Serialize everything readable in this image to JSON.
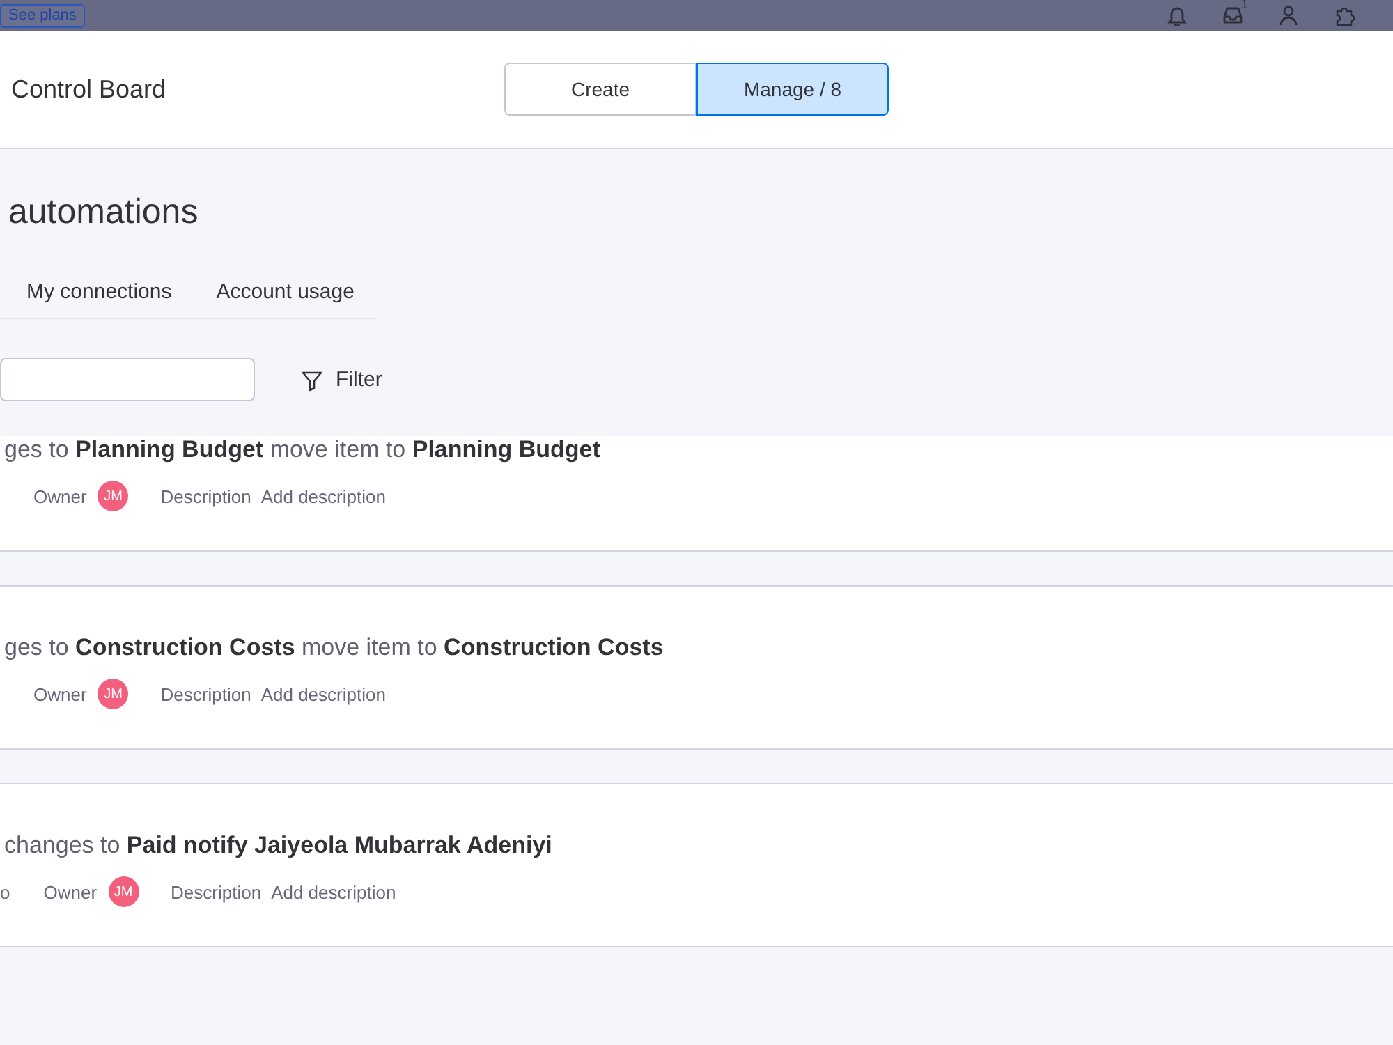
{
  "top_bar": {
    "see_plans": "See plans",
    "inbox_count": "1"
  },
  "header": {
    "board_title": "Control Board",
    "view_toggle": [
      {
        "label": "Create",
        "selected": false
      },
      {
        "label": "Manage / 8",
        "selected": true
      }
    ]
  },
  "automations_panel": {
    "title": "automations",
    "tabs": [
      {
        "label": "My connections",
        "selected": false
      },
      {
        "label": "Account usage",
        "selected": false
      }
    ],
    "filter_button": "Filter"
  },
  "automations": [
    {
      "rule": "ges to **Planning Budget** move item to **Planning Budget**",
      "owner_label": "Owner",
      "owner_initials": "JM",
      "description_label": "Description",
      "description_value": "Add description"
    },
    {
      "rule": "ges to **Construction Costs** move item to **Construction Costs**",
      "owner_label": "Owner",
      "owner_initials": "JM",
      "description_label": "Description",
      "description_value": "Add description"
    },
    {
      "rule": "changes to **Paid notify Jaiyeola Mubarrak Adeniyi**",
      "lead": "o",
      "owner_label": "Owner",
      "owner_initials": "JM",
      "description_label": "Description",
      "description_value": "Add description"
    }
  ]
}
